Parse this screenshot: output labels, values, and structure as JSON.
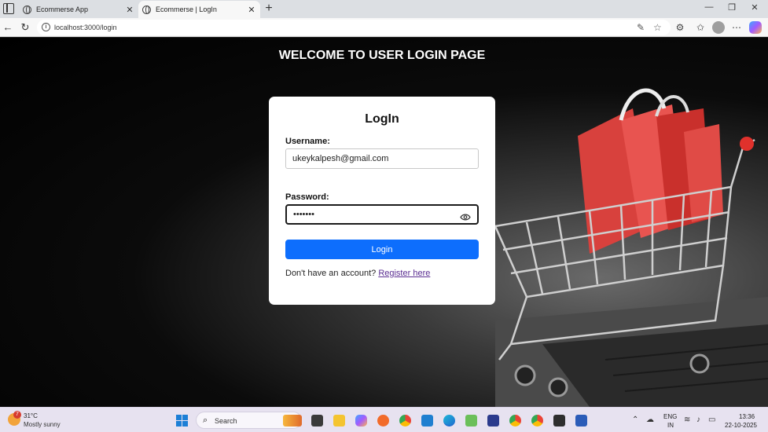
{
  "browser": {
    "tabs": [
      {
        "label": "Ecommerse App"
      },
      {
        "label": "Ecommerse | LogIn"
      }
    ],
    "url": "localhost:3000/login"
  },
  "page": {
    "hero_title": "WELCOME TO USER LOGIN PAGE",
    "card": {
      "title": "LogIn",
      "username_label": "Username:",
      "username_value": "ukeykalpesh@gmail.com",
      "password_label": "Password:",
      "password_value": "•••••••",
      "login_button": "Login",
      "register_prompt": "Don't have an account?",
      "register_link": "Register here"
    }
  },
  "colors": {
    "primary_button": "#0d6efd",
    "link": "#5a2d91"
  },
  "taskbar": {
    "weather_badge": "7",
    "weather_temp": "31°C",
    "weather_desc": "Mostly sunny",
    "search_label": "Search",
    "language": "ENG",
    "region": "IN",
    "time": "13:36",
    "date": "22-10-2025"
  }
}
